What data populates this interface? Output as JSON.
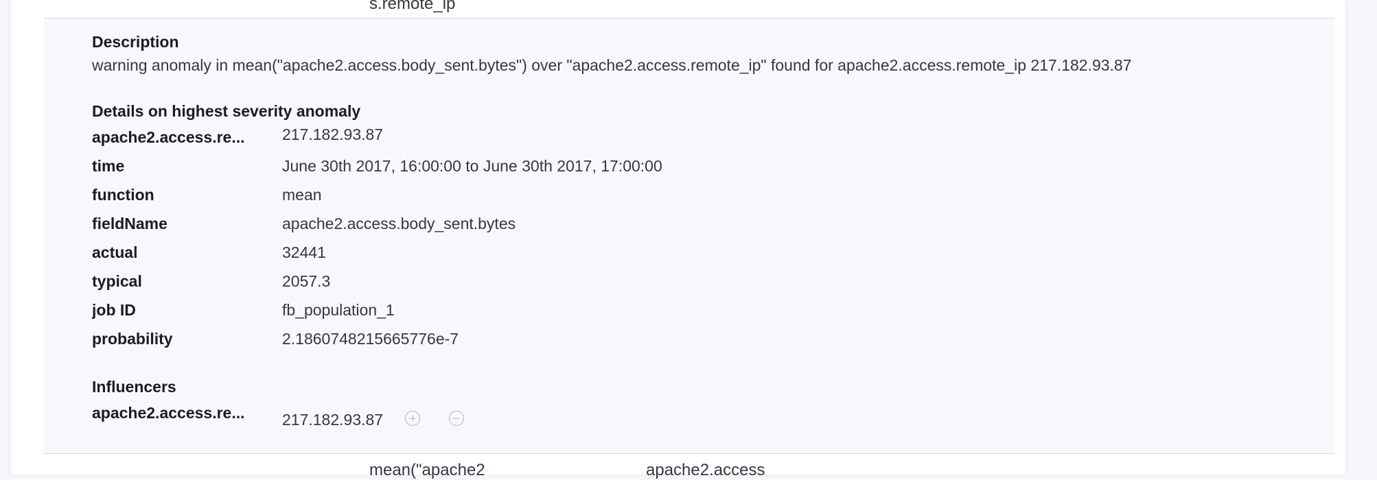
{
  "top_fragment": "s.remote_ip",
  "description": {
    "title": "Description",
    "text": "warning anomaly in mean(\"apache2.access.body_sent.bytes\") over \"apache2.access.remote_ip\" found for apache2.access.remote_ip 217.182.93.87"
  },
  "details": {
    "title": "Details on highest severity anomaly",
    "rows": [
      {
        "label": "apache2.access.re...",
        "value": "217.182.93.87"
      },
      {
        "label": "time",
        "value": "June 30th 2017, 16:00:00 to June 30th 2017, 17:00:00"
      },
      {
        "label": "function",
        "value": "mean"
      },
      {
        "label": "fieldName",
        "value": "apache2.access.body_sent.bytes"
      },
      {
        "label": "actual",
        "value": "32441"
      },
      {
        "label": "typical",
        "value": "2057.3"
      },
      {
        "label": "job ID",
        "value": "fb_population_1"
      },
      {
        "label": "probability",
        "value": "2.1860748215665776e-7"
      }
    ]
  },
  "influencers": {
    "title": "Influencers",
    "label": "apache2.access.re...",
    "value": "217.182.93.87",
    "add_filter_icon": "plus-circle-icon",
    "remove_filter_icon": "minus-circle-icon"
  },
  "bottom_fragments": {
    "col1": "mean(\"apache2",
    "col2": "apache2.access"
  }
}
